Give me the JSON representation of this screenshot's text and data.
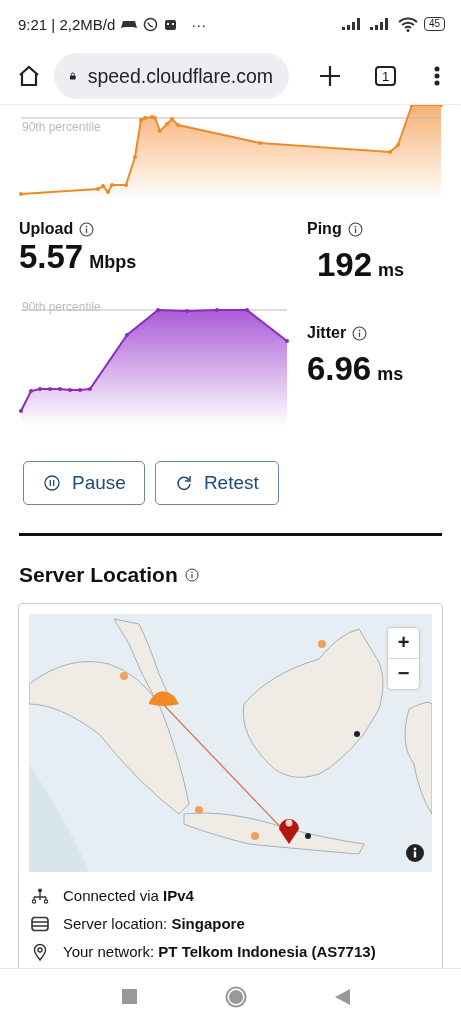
{
  "status_bar": {
    "time_and_data": "9:21 | 2,2MB/d",
    "more": "···",
    "battery": "45"
  },
  "browser": {
    "url": "speed.cloudflare.com",
    "tab_count": "1"
  },
  "download": {
    "percentile_label": "90th percentile"
  },
  "upload": {
    "label": "Upload",
    "value": "5.57",
    "unit": "Mbps",
    "percentile_label": "90th percentile"
  },
  "ping": {
    "label": "Ping",
    "value": "192",
    "unit": "ms"
  },
  "jitter": {
    "label": "Jitter",
    "value": "6.96",
    "unit": "ms"
  },
  "buttons": [
    {
      "kind": "pause",
      "label": "Pause"
    },
    {
      "kind": "retest",
      "label": "Retest"
    }
  ],
  "server_location": {
    "title": "Server Location",
    "map": {
      "kind": "picture",
      "zoom_in": "+",
      "zoom_out": "−"
    },
    "details": [
      {
        "kind": "network",
        "text": "Connected via **IPv4**"
      },
      {
        "kind": "server",
        "text": "Server location: **Singapore**"
      },
      {
        "kind": "pin",
        "text": "Your network: **PT Telkom Indonesia (AS7713)**"
      }
    ]
  }
}
